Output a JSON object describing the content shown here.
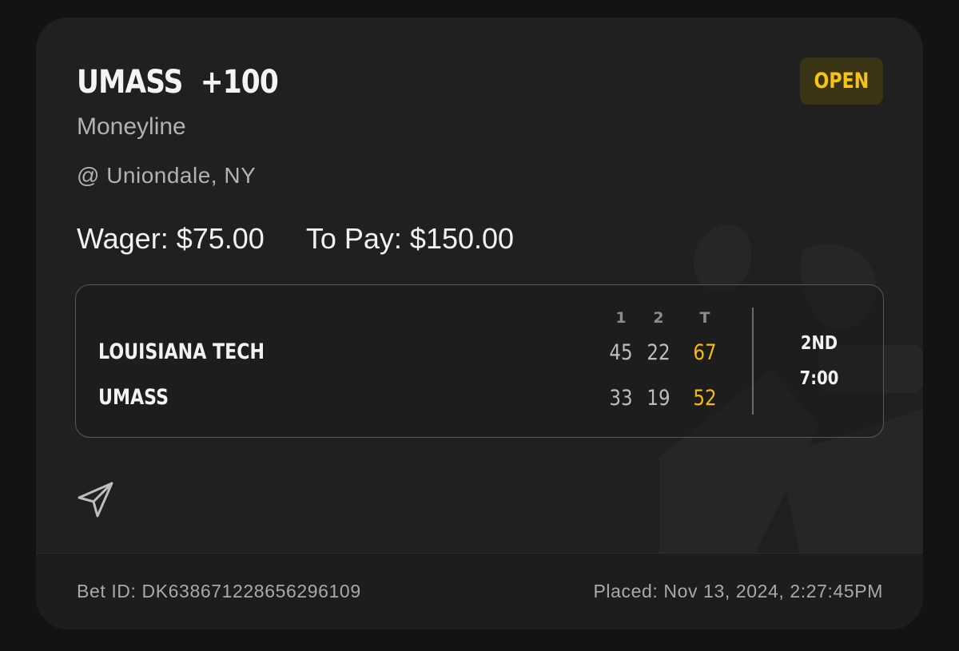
{
  "bet": {
    "selection": "UMASS",
    "odds": "+100",
    "status": "OPEN",
    "market": "Moneyline",
    "location": "@ Uniondale, NY",
    "wager_label": "Wager:",
    "wager": "$75.00",
    "to_pay_label": "To Pay:",
    "to_pay": "$150.00"
  },
  "scoreboard": {
    "headers": [
      "1",
      "2",
      "T"
    ],
    "teams": [
      {
        "name": "LOUISIANA TECH",
        "q1": "45",
        "q2": "22",
        "total": "67"
      },
      {
        "name": "UMASS",
        "q1": "33",
        "q2": "19",
        "total": "52"
      }
    ],
    "period": "2ND",
    "clock": "7:00"
  },
  "footer": {
    "bet_id_label": "Bet ID:",
    "bet_id": "DK638671228656296109",
    "placed_label": "Placed:",
    "placed": "Nov 13, 2024, 2:27:45PM"
  },
  "icons": {
    "share": "paper-plane-icon",
    "watermark": "crown-logo-watermark"
  },
  "colors": {
    "accent": "#f5c512",
    "total_score": "#f5b912",
    "card_bg": "#202020",
    "page_bg": "#131313"
  }
}
